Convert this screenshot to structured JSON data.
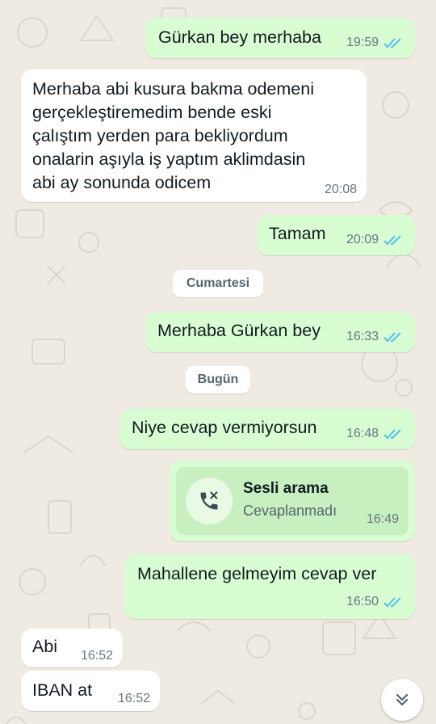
{
  "chat": {
    "messages": [
      {
        "direction": "out",
        "text": "Gürkan bey merhaba",
        "time": "19:59",
        "status": "read"
      },
      {
        "direction": "in",
        "lines": [
          "Merhaba abi kusura bakma odemeni",
          "gerçekleştiremedim bende eski",
          "çalıştım yerden para bekliyordum",
          "onalarin aşıyla iş yaptım aklimdasin",
          "abi ay sonunda odicem"
        ],
        "time": "20:08"
      },
      {
        "direction": "out",
        "text": "Tamam",
        "time": "20:09",
        "status": "read"
      },
      {
        "direction": "out",
        "text": "Merhaba Gürkan bey",
        "time": "16:33",
        "status": "read"
      },
      {
        "direction": "out",
        "text": "Niye cevap vermiyorsun",
        "time": "16:48",
        "status": "read"
      },
      {
        "direction": "out",
        "type": "call",
        "title": "Sesli arama",
        "subtitle": "Cevaplanmadı",
        "time": "16:49"
      },
      {
        "direction": "out",
        "text": "Mahallene gelmeyim cevap ver",
        "time": "16:50",
        "status": "read"
      },
      {
        "direction": "in",
        "text": "Abi",
        "time": "16:52"
      },
      {
        "direction": "in",
        "text": "IBAN at",
        "time": "16:52"
      }
    ],
    "date_separators": [
      "Cumartesi",
      "Bugün"
    ]
  },
  "icons": {
    "read_receipt": "double-check-icon",
    "call": "missed-call-icon",
    "scroll": "chevron-double-down-icon"
  },
  "colors": {
    "outgoing_bubble": "#d9fdd3",
    "incoming_bubble": "#ffffff",
    "background": "#efeae2",
    "read_tick": "#53bdeb",
    "call_card": "#c8efc0"
  }
}
